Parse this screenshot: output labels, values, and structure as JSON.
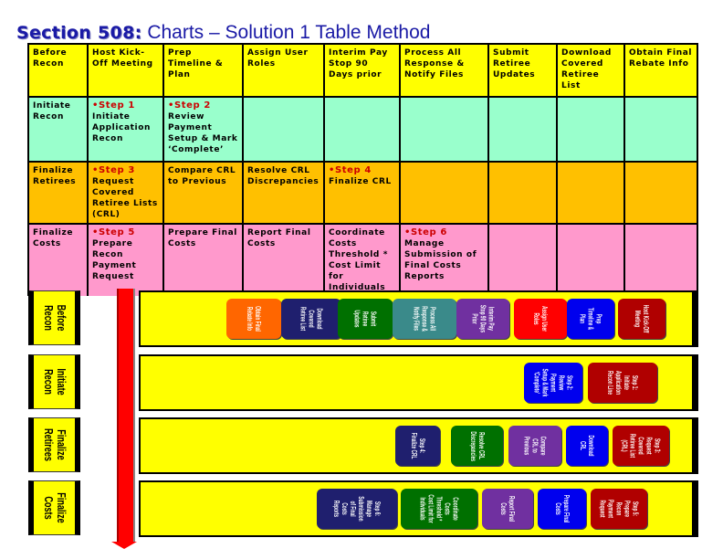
{
  "title": {
    "prefix": "Section 508:",
    "rest": " Charts – Solution 1 Table Method"
  },
  "table": {
    "header": [
      "Before Recon",
      "Host Kick-Off Meeting",
      "Prep Timeline & Plan",
      "Assign User Roles",
      "Interim Pay Stop 90 Days prior",
      "Process All Response & Notify Files",
      "Submit Retiree Updates",
      "Download Covered Retiree List",
      "Obtain Final Rebate Info"
    ],
    "rows": [
      {
        "phase": "Initiate Recon",
        "cells": [
          {
            "step": "•Step 1",
            "text": "Initiate Application Recon"
          },
          {
            "step": "•Step 2",
            "text": "Review Payment Setup & Mark ‘Complete’"
          },
          {
            "step": "",
            "text": ""
          },
          {
            "step": "",
            "text": ""
          },
          {
            "step": "",
            "text": ""
          },
          {
            "step": "",
            "text": ""
          },
          {
            "step": "",
            "text": ""
          },
          {
            "step": "",
            "text": ""
          }
        ]
      },
      {
        "phase": "Finalize Retirees",
        "cells": [
          {
            "step": "•Step 3",
            "text": "Request Covered Retiree Lists (CRL)"
          },
          {
            "step": "",
            "text": "Compare CRL to Previous"
          },
          {
            "step": "",
            "text": "Resolve CRL Discrepancies"
          },
          {
            "step": "•Step 4",
            "text": "Finalize CRL"
          },
          {
            "step": "",
            "text": ""
          },
          {
            "step": "",
            "text": ""
          },
          {
            "step": "",
            "text": ""
          },
          {
            "step": "",
            "text": ""
          }
        ]
      },
      {
        "phase": "Finalize Costs",
        "cells": [
          {
            "step": "•Step 5",
            "text": "Prepare Recon Payment Request"
          },
          {
            "step": "",
            "text": "Prepare Final Costs"
          },
          {
            "step": "",
            "text": "Report Final Costs"
          },
          {
            "step": "",
            "text": "Coordinate Costs Threshold * Cost Limit for Individuals"
          },
          {
            "step": "•Step 6",
            "text": "Manage Submission of Final Costs Reports"
          },
          {
            "step": "",
            "text": ""
          },
          {
            "step": "",
            "text": ""
          },
          {
            "step": "",
            "text": ""
          }
        ]
      }
    ]
  },
  "lanes": [
    {
      "label1": "Before",
      "label2": "Recon",
      "boxes": [
        {
          "text": "Obtain Final Rebate Info",
          "color": "#ff6600"
        },
        {
          "text": "Download Covered Retiree List",
          "color": "#1f1f6e"
        },
        {
          "text": "Submit Retiree Updates",
          "color": "#007000"
        },
        {
          "text": "Process All Response & Notify Files",
          "color": "#3a8a8a"
        },
        {
          "text": "Interim Pay Stop 90 Days Prior",
          "color": "#7030a0"
        },
        {
          "text": "Assign User Roles",
          "color": "#ff0000"
        },
        {
          "text": "Prep Timeline & Plan",
          "color": "#0000ee"
        },
        {
          "text": "Host Kick-Off Meeting",
          "color": "#b00000"
        }
      ]
    },
    {
      "label1": "Initiate",
      "label2": "Recon",
      "boxes": [
        {
          "text": "Step 2: Review Payment Setup & Mark ‘Complete’",
          "color": "#0000ee"
        },
        {
          "text": "Step 1: Initiate Application Recon Line",
          "color": "#b00000"
        }
      ]
    },
    {
      "label1": "Finalize",
      "label2": "Retirees",
      "boxes": [
        {
          "text": "Step 4: Finalize CRL",
          "color": "#1f1f6e"
        },
        {
          "text": "Resolve CRL Discrepancies",
          "color": "#007000"
        },
        {
          "text": "Compare CRL to Previous",
          "color": "#7030a0"
        },
        {
          "text": "Download CRL",
          "color": "#0000ee"
        },
        {
          "text": "Step 3: Request Covered Retiree List (CRL)",
          "color": "#b00000"
        }
      ]
    },
    {
      "label1": "Finalize",
      "label2": "Costs",
      "boxes": [
        {
          "text": "Step 6: Manage Submission of Final Costs Reports",
          "color": "#1f1f6e"
        },
        {
          "text": "Coordinate Costs Threshold * Cost Limit for Individuals",
          "color": "#007000"
        },
        {
          "text": "Report Final Costs",
          "color": "#7030a0"
        },
        {
          "text": "Prepare Final Costs",
          "color": "#0000ee"
        },
        {
          "text": "Step 5: Prepare Recon Payment Request",
          "color": "#b00000"
        }
      ]
    }
  ]
}
